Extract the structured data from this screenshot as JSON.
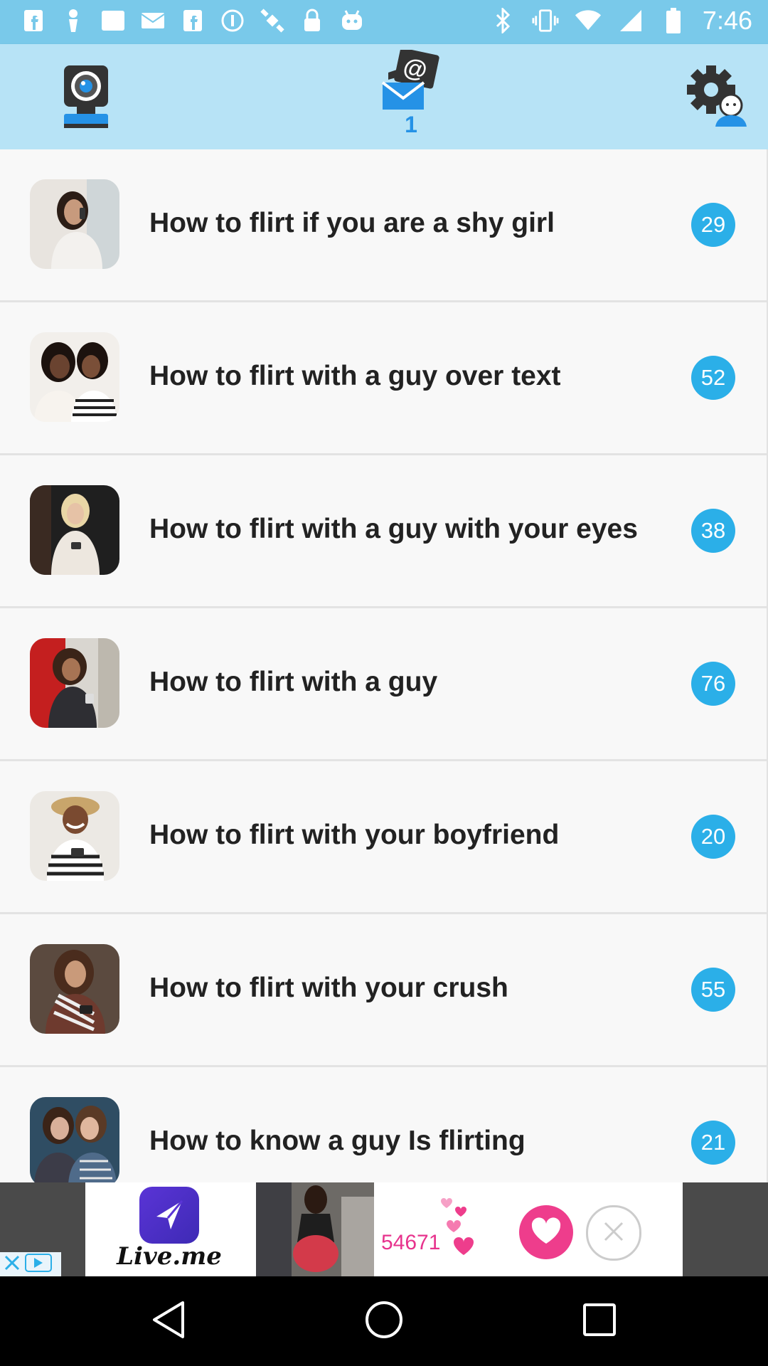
{
  "status_bar": {
    "time": "7:46",
    "left_icons": [
      "facebook-icon",
      "notification-icon",
      "square-icon",
      "mail-icon",
      "facebook-icon",
      "info-icon",
      "satellite-icon",
      "lock-icon",
      "android-icon"
    ],
    "right_icons": [
      "bluetooth-icon",
      "vibrate-icon",
      "wifi-icon",
      "signal-icon",
      "battery-icon"
    ]
  },
  "toolbar": {
    "camera_icon": "webcam-icon",
    "inbox_icon": "mail-icon",
    "inbox_count": "1",
    "settings_icon": "settings-user-icon"
  },
  "list": {
    "items": [
      {
        "title": "How to flirt if you are a shy girl",
        "count": "29"
      },
      {
        "title": "How to flirt with a guy over text",
        "count": "52"
      },
      {
        "title": "How to flirt with a guy with your eyes",
        "count": "38"
      },
      {
        "title": "How to flirt with a guy",
        "count": "76"
      },
      {
        "title": "How to flirt with your boyfriend",
        "count": "20"
      },
      {
        "title": "How to flirt with your crush",
        "count": "55"
      },
      {
        "title": "How to know a guy Is flirting",
        "count": "21"
      }
    ]
  },
  "ad": {
    "logo_text": "Live.me",
    "likes_count": "54671"
  },
  "colors": {
    "status_bar": "#79c9ea",
    "toolbar": "#b7e3f6",
    "badge": "#2bafe8",
    "inbox_count": "#2592e6"
  }
}
